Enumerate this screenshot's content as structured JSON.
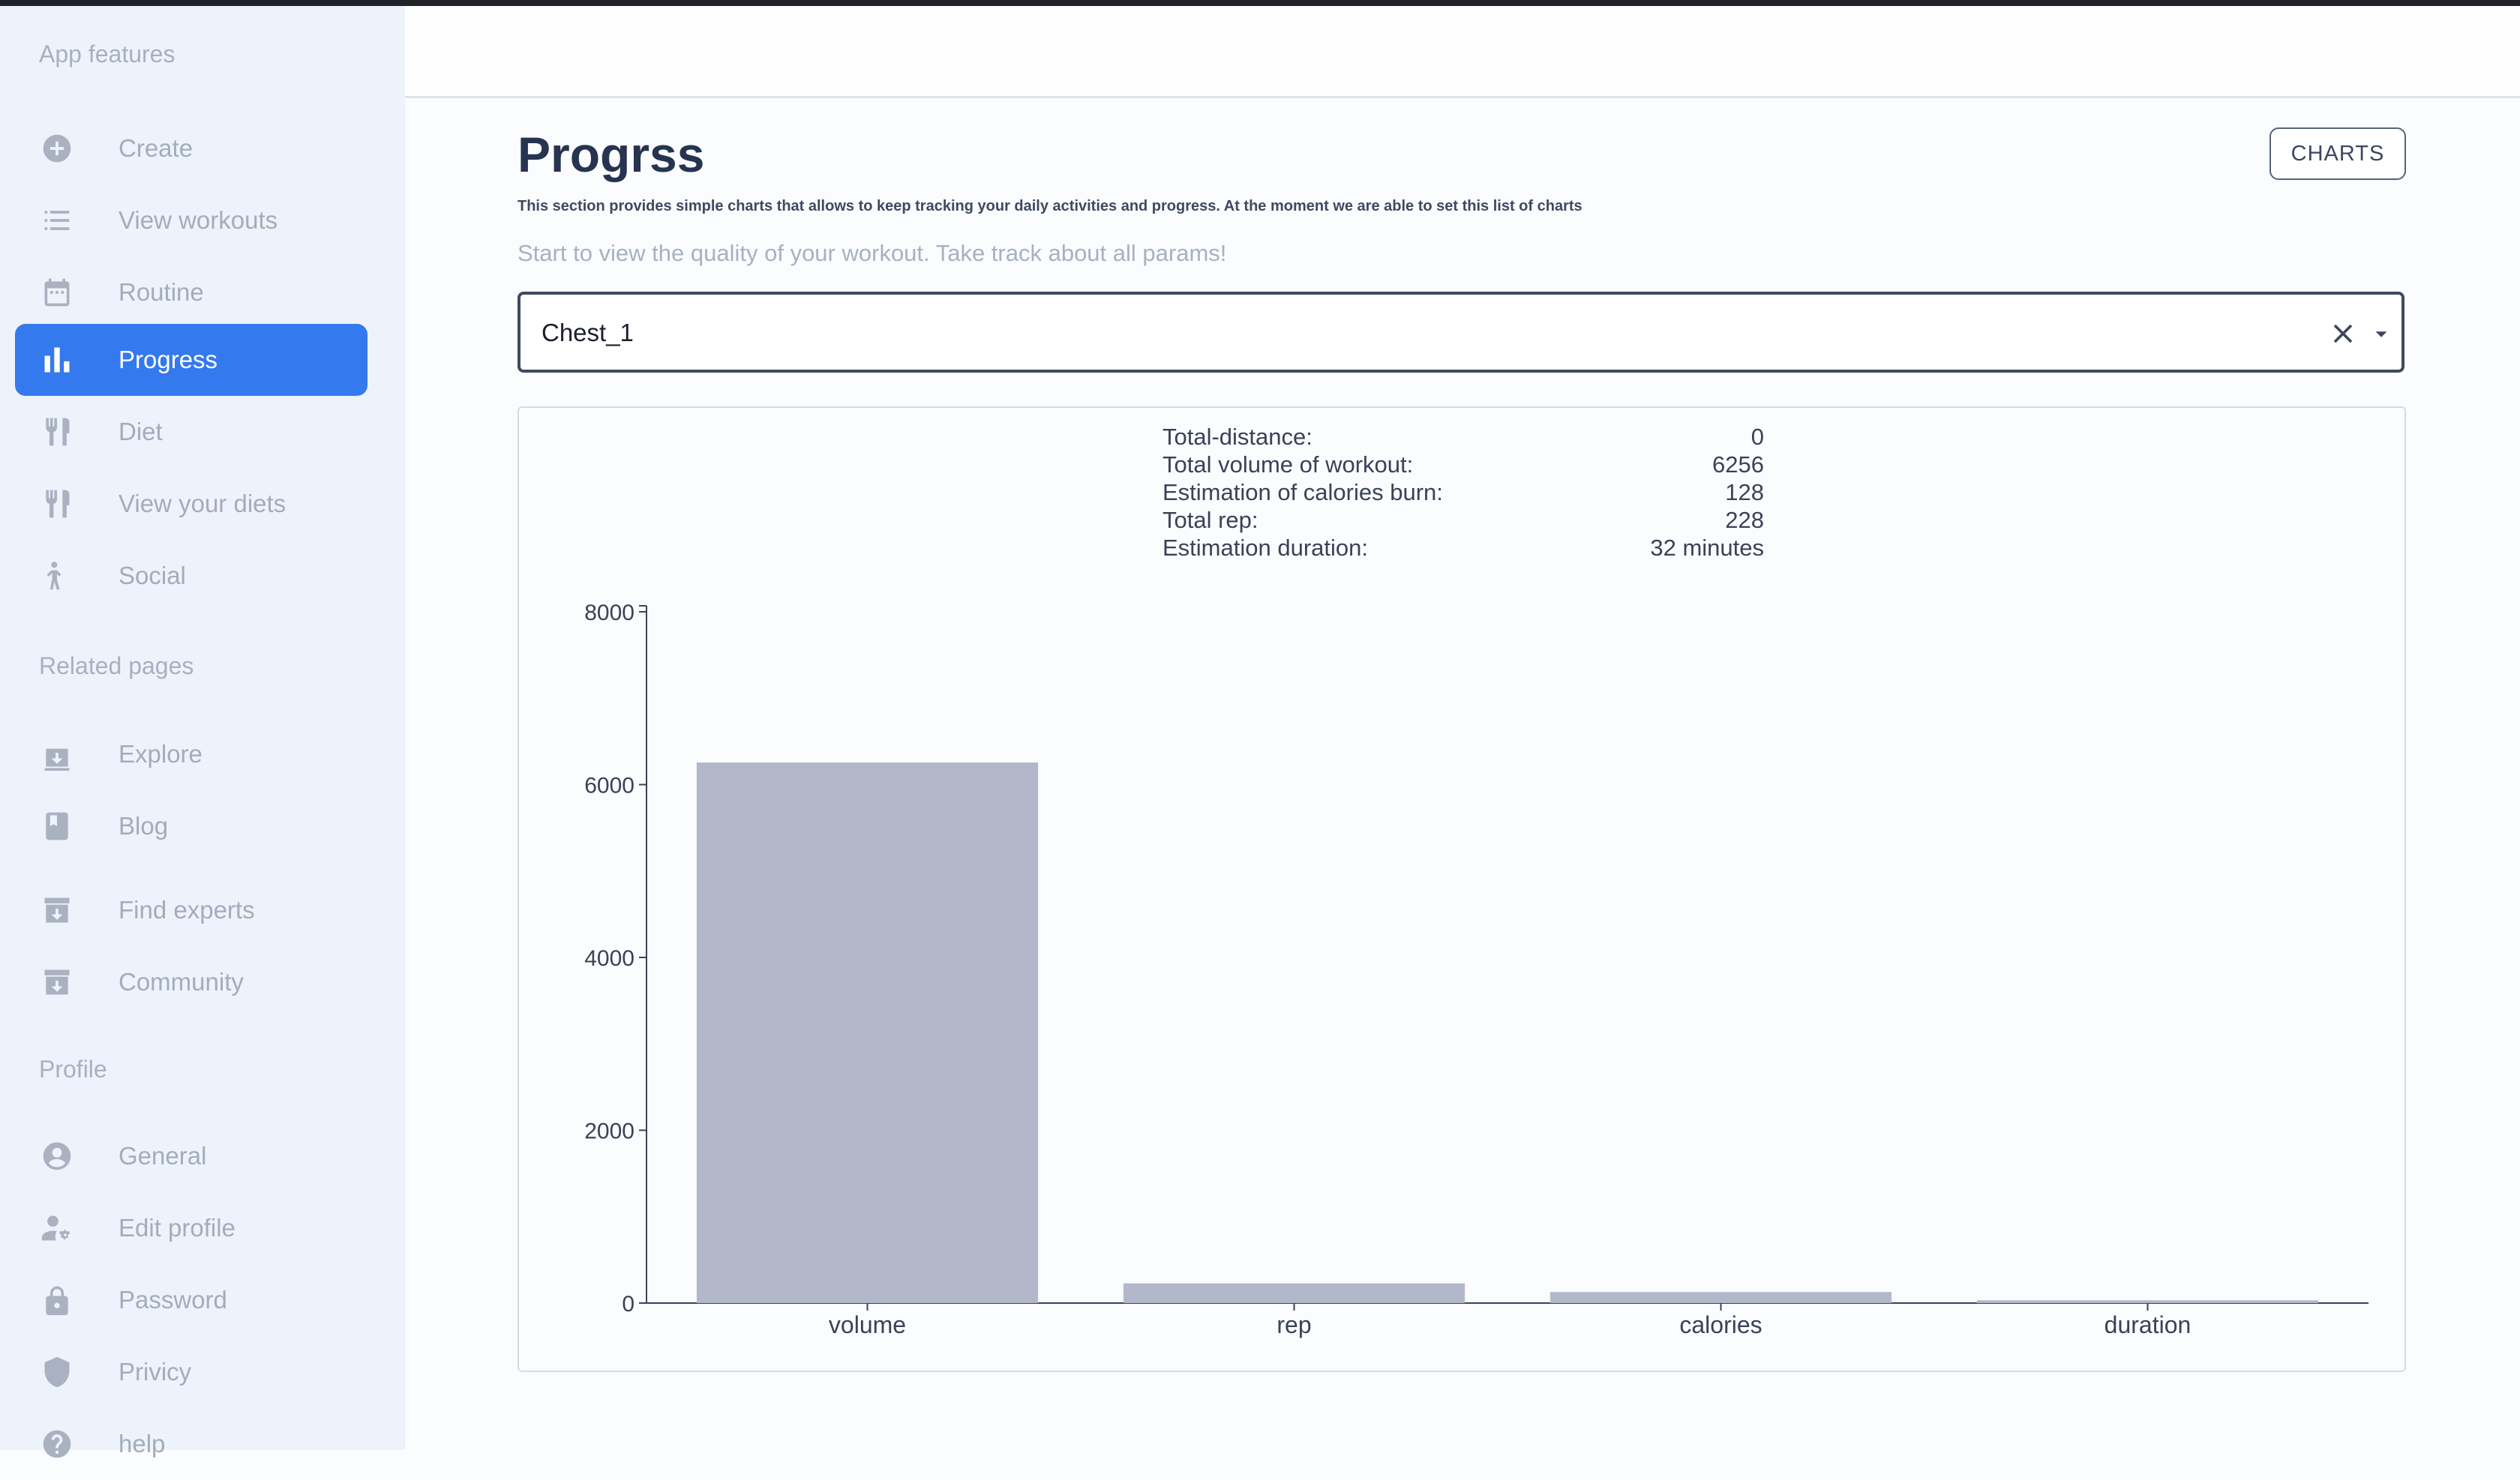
{
  "sidebar": {
    "sections": {
      "app_features": "App features",
      "related_pages": "Related pages",
      "profile": "Profile"
    },
    "items": [
      {
        "label": "Create",
        "icon": "add-circle-icon"
      },
      {
        "label": "View workouts",
        "icon": "list-icon"
      },
      {
        "label": "Routine",
        "icon": "calendar-icon"
      },
      {
        "label": "Progress",
        "icon": "bar-chart-icon",
        "active": true
      },
      {
        "label": "Diet",
        "icon": "utensils-icon"
      },
      {
        "label": "View your diets",
        "icon": "utensils-icon"
      },
      {
        "label": "Social",
        "icon": "person-icon"
      },
      {
        "label": "Explore",
        "icon": "archive-icon"
      },
      {
        "label": "Blog",
        "icon": "book-icon"
      },
      {
        "label": "Find experts",
        "icon": "archive-icon"
      },
      {
        "label": "Community",
        "icon": "archive-icon"
      },
      {
        "label": "General",
        "icon": "account-circle-icon"
      },
      {
        "label": "Edit profile",
        "icon": "user-settings-icon"
      },
      {
        "label": "Password",
        "icon": "lock-icon"
      },
      {
        "label": "Privicy",
        "icon": "shield-icon"
      },
      {
        "label": "help",
        "icon": "help-icon"
      }
    ]
  },
  "main": {
    "title": "Progrss",
    "charts_button": "CHARTS",
    "description": "This section provides simple charts that allows to keep tracking your daily activities and progress. At the moment we are able to set this list of charts",
    "subtitle": "Start to view the quality of your workout. Take track about all params!",
    "select_value": "Chest_1",
    "stats": [
      {
        "label": "Total-distance:",
        "value": "0"
      },
      {
        "label": "Total volume of workout:",
        "value": "6256"
      },
      {
        "label": "Estimation of calories burn:",
        "value": "128"
      },
      {
        "label": "Total rep:",
        "value": "228"
      },
      {
        "label": "Estimation duration:",
        "value": "32 minutes"
      }
    ]
  },
  "colors": {
    "accent": "#3479ee",
    "bar": "#b2b8c9",
    "sidebar_bg": "#eef3fb"
  },
  "chart_data": {
    "type": "bar",
    "categories": [
      "volume",
      "rep",
      "calories",
      "duration"
    ],
    "values": [
      6256,
      228,
      128,
      32
    ],
    "ylim": [
      0,
      8000
    ],
    "yticks": [
      0,
      2000,
      4000,
      6000,
      8000
    ],
    "grid": false
  }
}
